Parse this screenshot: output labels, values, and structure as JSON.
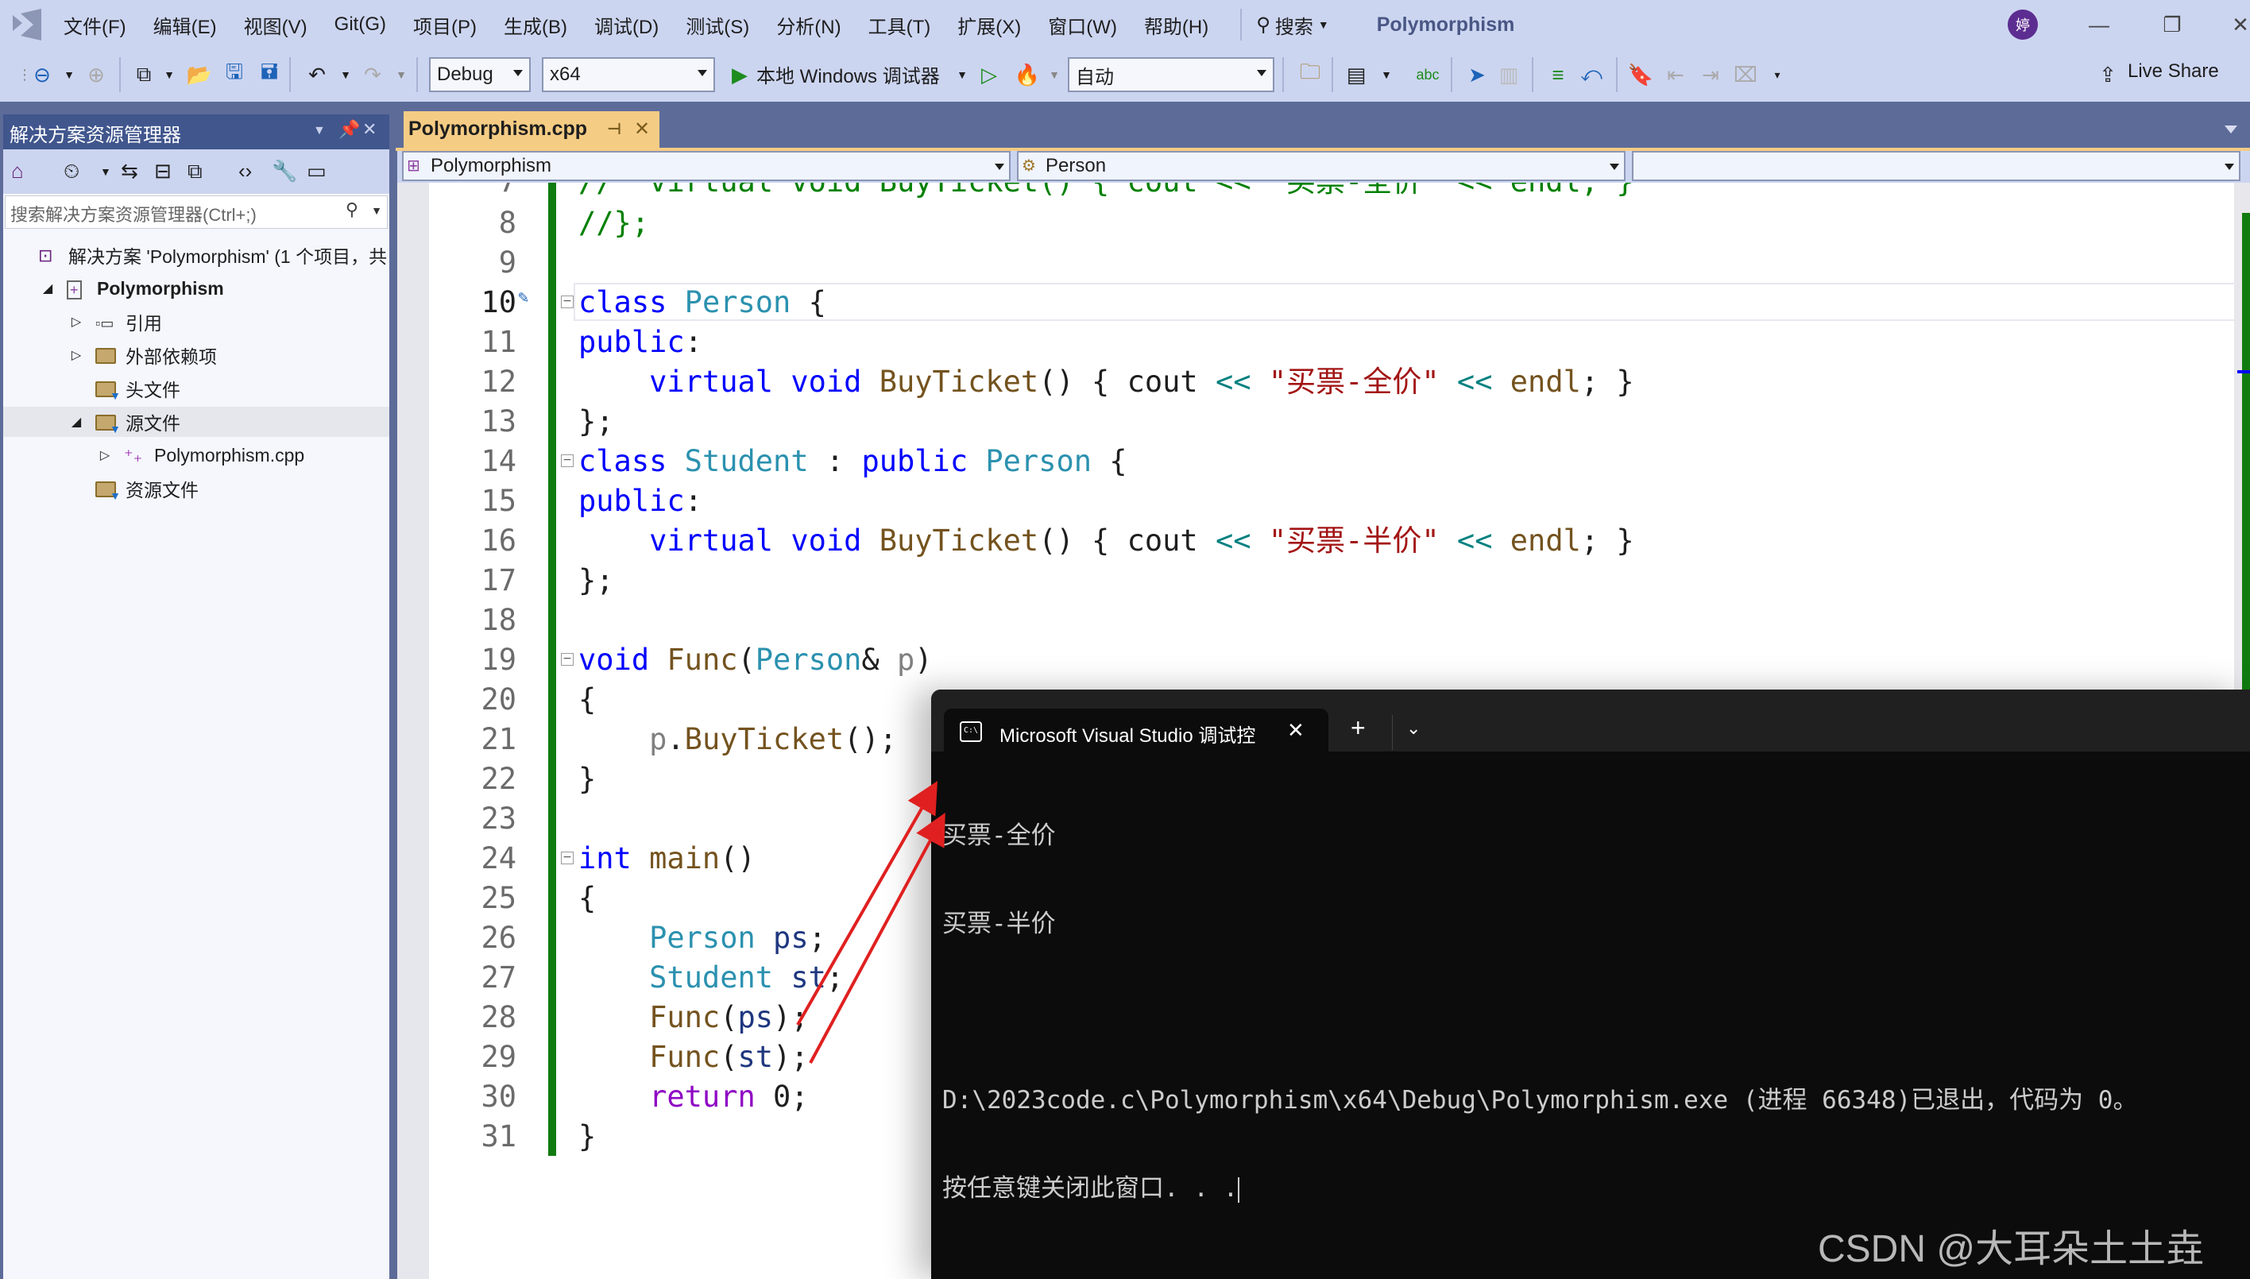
{
  "menubar": {
    "items": [
      "文件(F)",
      "编辑(E)",
      "视图(V)",
      "Git(G)",
      "项目(P)",
      "生成(B)",
      "调试(D)",
      "测试(S)",
      "分析(N)",
      "工具(T)",
      "扩展(X)",
      "窗口(W)",
      "帮助(H)"
    ],
    "search_label": "搜索",
    "solution_title": "Polymorphism",
    "avatar_initial": "婷",
    "minimize": "—",
    "restore": "❐",
    "close": "✕"
  },
  "toolbar": {
    "configuration": "Debug",
    "platform": "x64",
    "start_debugger_label": "本地 Windows 调试器",
    "auto_label": "自动",
    "live_share_label": "Live Share"
  },
  "solution_explorer": {
    "title": "解决方案资源管理器",
    "search_placeholder": "搜索解决方案资源管理器(Ctrl+;)",
    "tree": [
      {
        "label": "解决方案 'Polymorphism' (1 个项目，共",
        "icon": "solution-icon",
        "level": 0,
        "expander": ""
      },
      {
        "label": "Polymorphism",
        "icon": "cpp-project-icon",
        "level": 1,
        "expander": "expanded",
        "bold": true
      },
      {
        "label": "引用",
        "icon": "references-icon",
        "level": 2,
        "expander": "collapsed"
      },
      {
        "label": "外部依赖项",
        "icon": "external-deps-icon",
        "level": 2,
        "expander": "collapsed"
      },
      {
        "label": "头文件",
        "icon": "filter-folder-icon",
        "level": 2,
        "expander": ""
      },
      {
        "label": "源文件",
        "icon": "filter-folder-icon",
        "level": 2,
        "expander": "expanded",
        "selected": true
      },
      {
        "label": "Polymorphism.cpp",
        "icon": "cpp-file-icon",
        "level": 3,
        "expander": "collapsed"
      },
      {
        "label": "资源文件",
        "icon": "filter-folder-icon",
        "level": 2,
        "expander": ""
      }
    ]
  },
  "editor": {
    "tab_label": "Polymorphism.cpp",
    "nav_project": "Polymorphism",
    "nav_scope": "Person",
    "nav_member": "",
    "current_line": 10
  },
  "console": {
    "tab_title": "Microsoft Visual Studio 调试控",
    "output_lines": [
      "买票-全价",
      "买票-半价",
      "",
      "D:\\2023code.c\\Polymorphism\\x64\\Debug\\Polymorphism.exe (进程 66348)已退出，代码为 0。",
      "按任意键关闭此窗口. . ."
    ],
    "watermark": "CSDN @大耳朵土土垚"
  },
  "colors": {
    "accent_tab": "#f5cc84",
    "change_bar": "#107c10",
    "band": "#5d6b99",
    "arrow": "#e02020"
  }
}
